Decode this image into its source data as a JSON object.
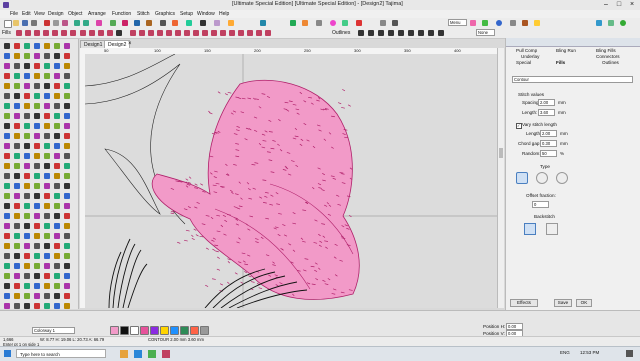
{
  "window": {
    "title": "[Ultimate Special Edition]  [Ultimate Special Edition] - [Design2]      Tajima]",
    "min": "–",
    "max": "□",
    "close": "×"
  },
  "menu": [
    "File",
    "Edit",
    "View",
    "Design",
    "Object",
    "Arrange",
    "Function",
    "Stitch",
    "Graphics",
    "Setup",
    "Window",
    "Help"
  ],
  "toolbar": {
    "fills_label": "Fills",
    "outlines_label": "Outlines",
    "menu_label": "Menu",
    "none_label": "None"
  },
  "tabs": [
    {
      "label": "Design1"
    },
    {
      "label": "Design2"
    }
  ],
  "ruler": {
    "top": [
      "50",
      "100",
      "150",
      "200",
      "250",
      "300",
      "350",
      "400"
    ]
  },
  "panel": {
    "tabs_row1": [
      "Pull Comp",
      "Bling Run",
      "Bling Fills"
    ],
    "tabs_row2": [
      "Underlay",
      "Connectors"
    ],
    "tabs_row3": [
      "Special",
      "Fills",
      "Outlines"
    ],
    "fill_type": "Contour",
    "stitch_values": "Stitch values",
    "spacing_label": "Spacing:",
    "spacing_value": "2.00",
    "spacing_unit": "mm",
    "length_label": "Length:",
    "length_value": "3.60",
    "length_unit": "mm",
    "vary_label": "Vary stitch length",
    "length2_label": "Length:",
    "length2_value": "2.00",
    "length2_unit": "mm",
    "chord_label": "Chord gap:",
    "chord_value": "0.30",
    "chord_unit": "mm",
    "random_label": "Random:",
    "random_value": "50",
    "random_unit": "%",
    "type_label": "Type",
    "offset_label": "Offset fraction:",
    "offset_value": "0",
    "backstitch_label": "Backstitch",
    "effects_btn": "Effects",
    "save_btn": "Save",
    "ok_btn": "OK"
  },
  "bottom": {
    "colorway": "Colorway 1",
    "position_h": "Position H:",
    "position_v": "Position V:",
    "pos_h_val": "0.00",
    "pos_v_val": "0.00"
  },
  "status": {
    "left": "1,666",
    "coords": "W: 8.77  H: 19.06  L: 20.73  A: 66.79",
    "info": "CONTOUR  2.00 mm  3.60 mm",
    "hint": "Enter pt 1 on side 1"
  },
  "taskbar": {
    "search": "Type here to search",
    "lang": "ENG",
    "time": "12:53 PM"
  },
  "colors": {
    "accent": "#e6529a",
    "fill": "#f29ac8",
    "stitch": "#b0206a"
  }
}
